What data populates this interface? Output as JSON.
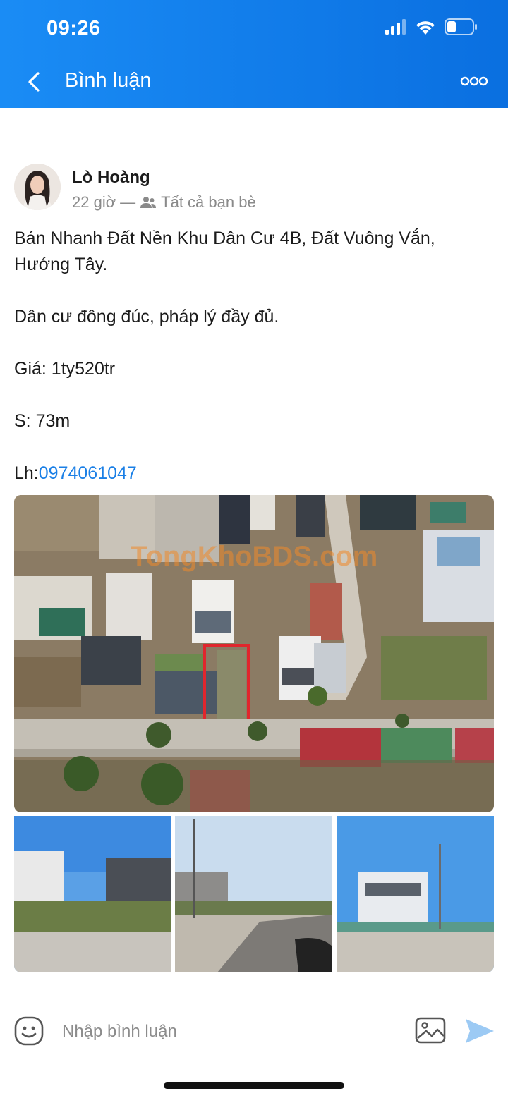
{
  "status_bar": {
    "time": "09:26"
  },
  "header": {
    "title": "Bình luận"
  },
  "post": {
    "author": "Lò Hoàng",
    "time_ago": "22 giờ",
    "separator": "—",
    "audience": "Tất cả bạn bè",
    "lines": [
      "Bán Nhanh Đất Nền Khu Dân Cư 4B, Đất Vuông Vắn, Hướng Tây.",
      "Dân cư đông đúc, pháp lý đầy đủ.",
      "Giá: 1ty520tr",
      "S: 73m"
    ],
    "contact_label": "Lh:",
    "contact_phone": "0974061047",
    "watermark": "TongKhoBDS.com"
  },
  "comment_bar": {
    "placeholder": "Nhập bình luận"
  },
  "colors": {
    "header_blue": "#1a8cf5",
    "link_blue": "#1a7fe6",
    "highlight_red": "#e0262d"
  }
}
